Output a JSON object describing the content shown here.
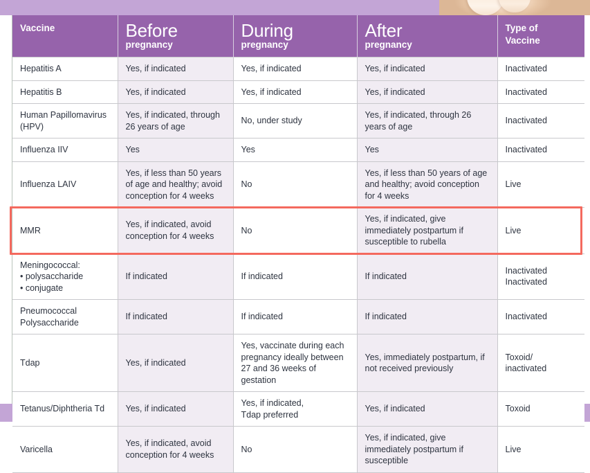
{
  "document": {
    "title": "Vaccines and Pregnancy Recommendation Table",
    "top_band_color": "#c3a5d6",
    "bottom_band_color": "#c3a5d6",
    "header_color": "#9663ab",
    "tint_color": "#f1ecf3",
    "highlight_color": "#f4695e",
    "photo_alt": "cropped photograph of skin and fingers"
  },
  "table": {
    "columns": [
      {
        "id": "vaccine",
        "label_main": "Vaccine",
        "label_sub": "",
        "style": "plain"
      },
      {
        "id": "before",
        "label_main": "Before",
        "label_sub": "pregnancy",
        "style": "big"
      },
      {
        "id": "during",
        "label_main": "During",
        "label_sub": "pregnancy",
        "style": "big"
      },
      {
        "id": "after",
        "label_main": "After",
        "label_sub": "pregnancy",
        "style": "big"
      },
      {
        "id": "type",
        "label_main": "Type of",
        "label_sub": "Vaccine",
        "style": "plain"
      }
    ],
    "tinted_columns": [
      "before",
      "after"
    ],
    "highlighted_row": "MMR",
    "rows": [
      {
        "vaccine": "Hepatitis A",
        "before": "Yes, if indicated",
        "during": "Yes, if indicated",
        "after": "Yes, if indicated",
        "type": "Inactivated"
      },
      {
        "vaccine": "Hepatitis B",
        "before": "Yes, if indicated",
        "during": "Yes, if indicated",
        "after": "Yes, if indicated",
        "type": "Inactivated"
      },
      {
        "vaccine": "Human Papillomavirus (HPV)",
        "before": "Yes, if indicated, through 26 years of age",
        "during": "No, under study",
        "after": "Yes, if indicated, through 26 years of age",
        "type": "Inactivated"
      },
      {
        "vaccine": "Influenza IIV",
        "before": "Yes",
        "during": "Yes",
        "after": "Yes",
        "type": "Inactivated"
      },
      {
        "vaccine": "Influenza LAIV",
        "before": "Yes, if less than 50 years of age and healthy; avoid conception for 4 weeks",
        "during": "No",
        "after": "Yes, if less than 50 years of age and healthy; avoid conception for 4 weeks",
        "type": "Live"
      },
      {
        "vaccine": "MMR",
        "before": "Yes, if indicated, avoid conception for 4 weeks",
        "during": "No",
        "after": "Yes, if indicated, give immediately postpartum if susceptible to rubella",
        "type": "Live"
      },
      {
        "vaccine": "Meningococcal:\n• polysaccharide\n• conjugate",
        "before": "If indicated",
        "during": "If indicated",
        "after": "If indicated",
        "type": "Inactivated\nInactivated"
      },
      {
        "vaccine": "Pneumococcal Polysaccharide",
        "before": "If indicated",
        "during": "If indicated",
        "after": "If indicated",
        "type": "Inactivated"
      },
      {
        "vaccine": "Tdap",
        "before": "Yes, if indicated",
        "during": "Yes, vaccinate during each pregnancy ideally between 27 and 36 weeks of gestation",
        "after": "Yes, immediately postpartum, if not received previously",
        "type": "Toxoid/\ninactivated"
      },
      {
        "vaccine": "Tetanus/Diphtheria Td",
        "before": "Yes, if indicated",
        "during": "Yes, if indicated,\nTdap preferred",
        "after": "Yes, if indicated",
        "type": "Toxoid"
      },
      {
        "vaccine": "Varicella",
        "before": "Yes, if indicated, avoid conception for 4 weeks",
        "during": "No",
        "after": "Yes, if indicated, give immediately postpartum if susceptible",
        "type": "Live"
      }
    ]
  }
}
